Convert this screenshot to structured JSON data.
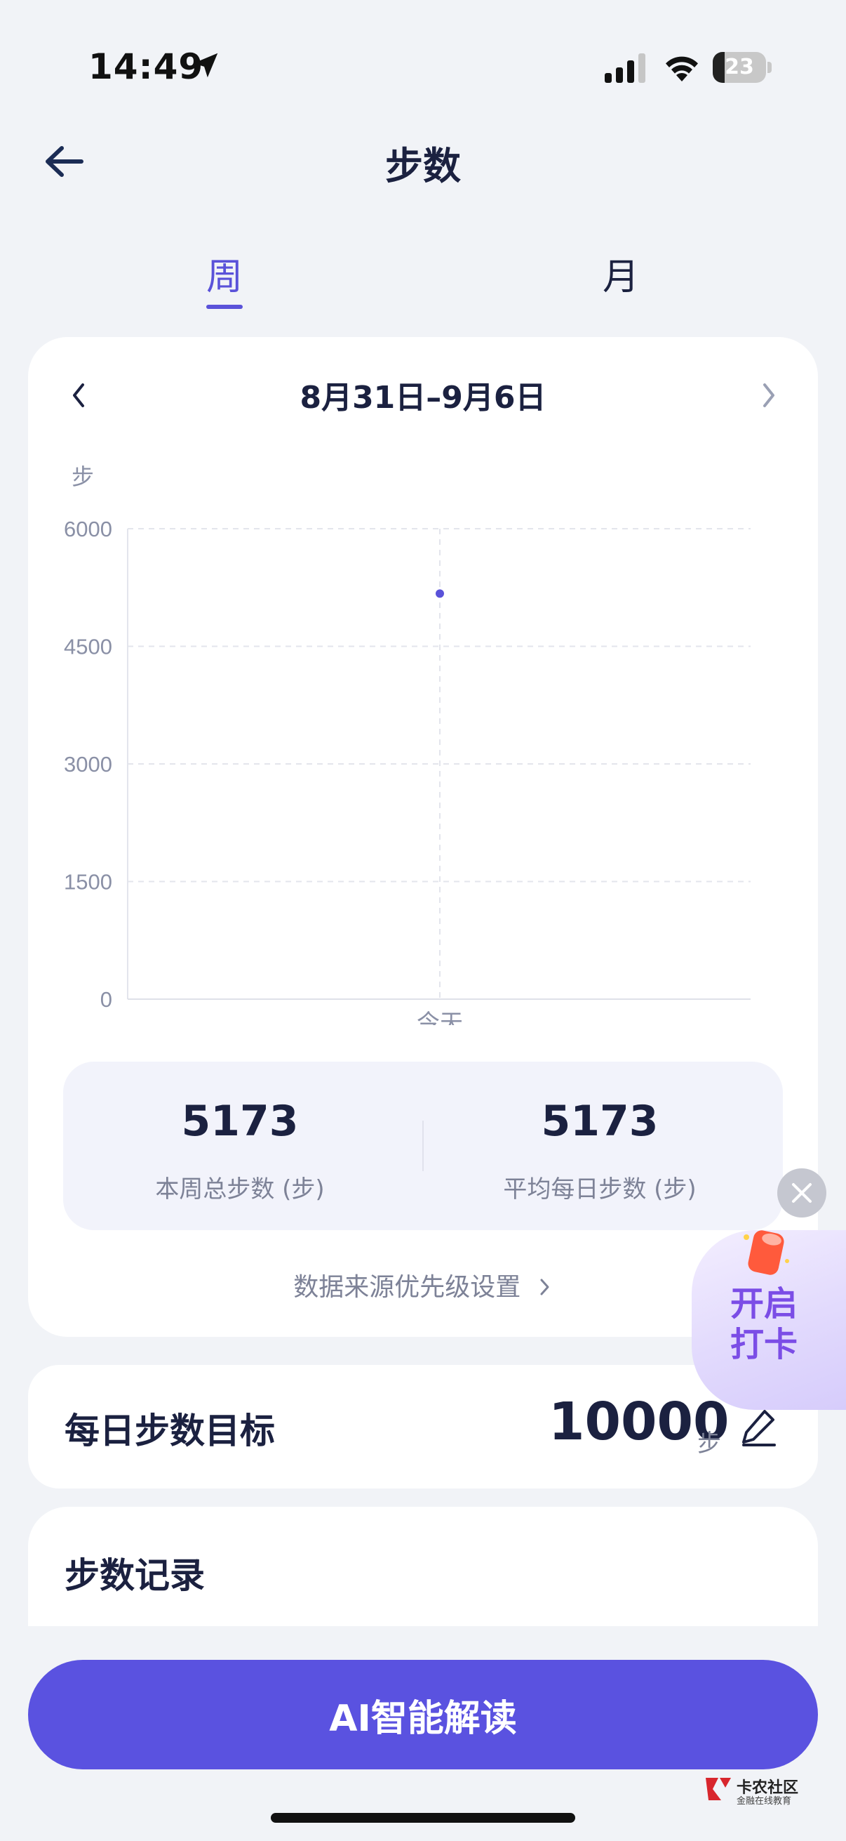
{
  "status_bar": {
    "time": "14:49",
    "battery": "23",
    "battery_level": 0.23
  },
  "header": {
    "title": "步数"
  },
  "tabs": [
    {
      "label": "周",
      "active": true
    },
    {
      "label": "月",
      "active": false
    }
  ],
  "week_card": {
    "date_range": "8月31日–9月6日",
    "unit": "步",
    "stats": {
      "total_value": "5173",
      "total_label": "本周总步数 (步)",
      "average_value": "5173",
      "average_label": "平均每日步数 (步)"
    },
    "source_link": "数据来源优先级设置"
  },
  "chart_data": {
    "type": "scatter",
    "x": [
      "今天"
    ],
    "values": [
      5173
    ],
    "yticks": [
      "0",
      "1500",
      "3000",
      "4500",
      "6000"
    ],
    "ylim": [
      0,
      6000
    ],
    "ylabel": "步",
    "grid": true,
    "color": "#5a52d9"
  },
  "goal": {
    "label": "每日步数目标",
    "value": "10000",
    "unit": "步"
  },
  "records": {
    "title": "步数记录"
  },
  "ai_button": {
    "label": "AI智能解读"
  },
  "floating_checkin": {
    "line1": "开启",
    "line2": "打卡"
  },
  "watermark": {
    "text": "卡农社区",
    "sub": "金融在线教育"
  },
  "colors": {
    "accent": "#5a52d9",
    "button": "#5a52e0",
    "background": "#f1f3f7"
  }
}
